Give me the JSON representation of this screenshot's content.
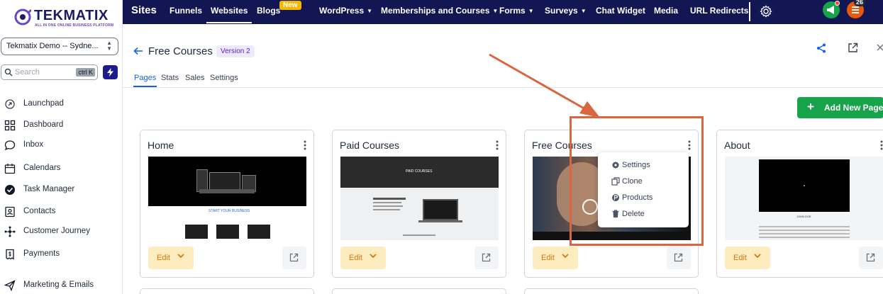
{
  "colors": {
    "topbar_bg": "#121652",
    "brand_purple": "#6b46c1",
    "accent_blue": "#155eef",
    "add_button": "#16a34a",
    "edit_button_bg": "#fdecc0",
    "edit_button_text": "#d97706",
    "annotation": "#d9663f",
    "new_badge": "#f5b800"
  },
  "brand": {
    "name": "TEKMATIX",
    "tagline": "ALL IN ONE ONLINE BUSINESS PLATFORM"
  },
  "sidebar": {
    "account": "Tekmatix Demo -- Sydne...",
    "search_placeholder": "Search",
    "search_shortcut": "ctrl K",
    "items": [
      {
        "label": "Launchpad",
        "icon": "rocket-icon"
      },
      {
        "label": "Dashboard",
        "icon": "dashboard-grid-icon"
      },
      {
        "label": "Inbox",
        "icon": "chat-bubble-icon"
      },
      {
        "label": "Calendars",
        "icon": "calendar-icon"
      },
      {
        "label": "Task Manager",
        "icon": "check-circle-icon"
      },
      {
        "label": "Contacts",
        "icon": "contact-card-icon"
      },
      {
        "label": "Customer Journey",
        "icon": "journey-network-icon"
      },
      {
        "label": "Payments",
        "icon": "receipt-icon"
      },
      {
        "label": "Marketing & Emails",
        "icon": "send-icon"
      }
    ]
  },
  "topbar": {
    "title": "Sites",
    "nav": [
      {
        "label": "Funnels"
      },
      {
        "label": "Websites",
        "active": true
      },
      {
        "label": "Blogs",
        "badge": "New"
      },
      {
        "label": "WordPress",
        "dropdown": true
      },
      {
        "label": "Memberships and Courses",
        "dropdown": true
      },
      {
        "label": "Forms",
        "dropdown": true
      },
      {
        "label": "Surveys",
        "dropdown": true
      },
      {
        "label": "Chat Widget"
      },
      {
        "label": "Media"
      },
      {
        "label": "URL Redirects"
      }
    ],
    "notification_count": "26"
  },
  "header": {
    "title": "Free Courses",
    "version": "Version 2",
    "tabs": [
      "Pages",
      "Stats",
      "Sales",
      "Settings"
    ],
    "active_tab": "Pages"
  },
  "add_page_label": "Add New Page",
  "cards": [
    {
      "title": "Home",
      "edit_label": "Edit",
      "thumb_caption": "START YOUR BUSINESS"
    },
    {
      "title": "Paid Courses",
      "edit_label": "Edit",
      "thumb_caption": "PAID COURSES"
    },
    {
      "title": "Free Courses",
      "edit_label": "Edit"
    },
    {
      "title": "About",
      "edit_label": "Edit",
      "thumb_caption": "JOHN DOE"
    }
  ],
  "card_menu": [
    {
      "label": "Settings",
      "icon": "gear-icon"
    },
    {
      "label": "Clone",
      "icon": "clone-icon"
    },
    {
      "label": "Products",
      "icon": "product-icon"
    },
    {
      "label": "Delete",
      "icon": "trash-icon"
    }
  ]
}
